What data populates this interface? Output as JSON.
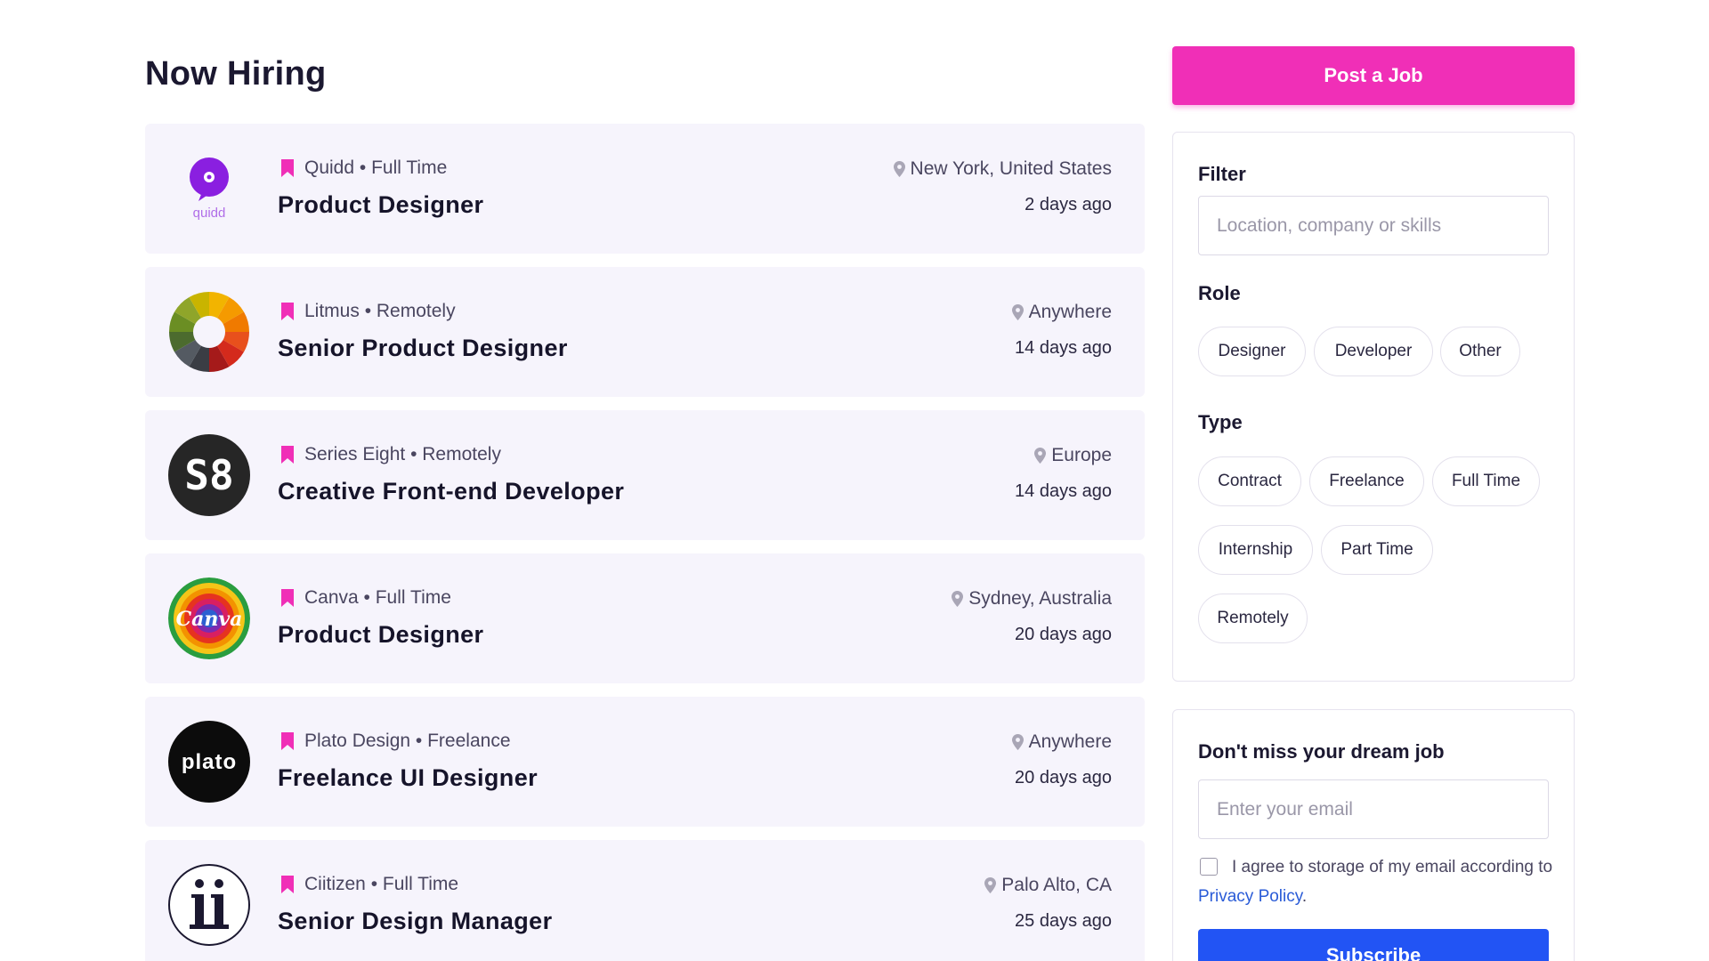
{
  "header": {
    "title": "Now Hiring"
  },
  "post_job": {
    "label": "Post a Job",
    "color": "#f02fb7"
  },
  "jobs": [
    {
      "company": "Quidd",
      "type": "Full Time",
      "title": "Product Designer",
      "location": "New York, United States",
      "posted": "2 days ago",
      "logo": "quidd-logo"
    },
    {
      "company": "Litmus",
      "type": "Remotely",
      "title": "Senior Product Designer",
      "location": "Anywhere",
      "posted": "14 days ago",
      "logo": "litmus-logo"
    },
    {
      "company": "Series Eight",
      "type": "Remotely",
      "title": "Creative Front-end Developer",
      "location": "Europe",
      "posted": "14 days ago",
      "logo": "series-eight-logo"
    },
    {
      "company": "Canva",
      "type": "Full Time",
      "title": "Product Designer",
      "location": "Sydney, Australia",
      "posted": "20 days ago",
      "logo": "canva-logo"
    },
    {
      "company": "Plato Design",
      "type": "Freelance",
      "title": "Freelance UI Designer",
      "location": "Anywhere",
      "posted": "20 days ago",
      "logo": "plato-logo"
    },
    {
      "company": "Ciitizen",
      "type": "Full Time",
      "title": "Senior Design Manager",
      "location": "Palo Alto, CA",
      "posted": "25 days ago",
      "logo": "ciitizen-logo"
    }
  ],
  "logo_text": {
    "quidd": "quidd",
    "series_eight": "S8",
    "canva": "Canva",
    "plato": "plato"
  },
  "filter": {
    "label": "Filter",
    "placeholder": "Location, company or skills",
    "role_label": "Role",
    "roles": [
      "Designer",
      "Developer",
      "Other"
    ],
    "type_label": "Type",
    "types": [
      "Contract",
      "Freelance",
      "Full Time",
      "Internship",
      "Part Time",
      "Remotely"
    ]
  },
  "subscribe": {
    "heading": "Don't miss your dream job",
    "placeholder": "Enter your email",
    "consent_text": "I agree to storage of my email according to",
    "privacy_link": "Privacy Policy",
    "period": ".",
    "button": "Subscribe",
    "button_color": "#2254f4"
  },
  "colors": {
    "accent_pink": "#f02fb7",
    "card_bg": "#f6f4fc",
    "link_blue": "#2a5bd7"
  }
}
